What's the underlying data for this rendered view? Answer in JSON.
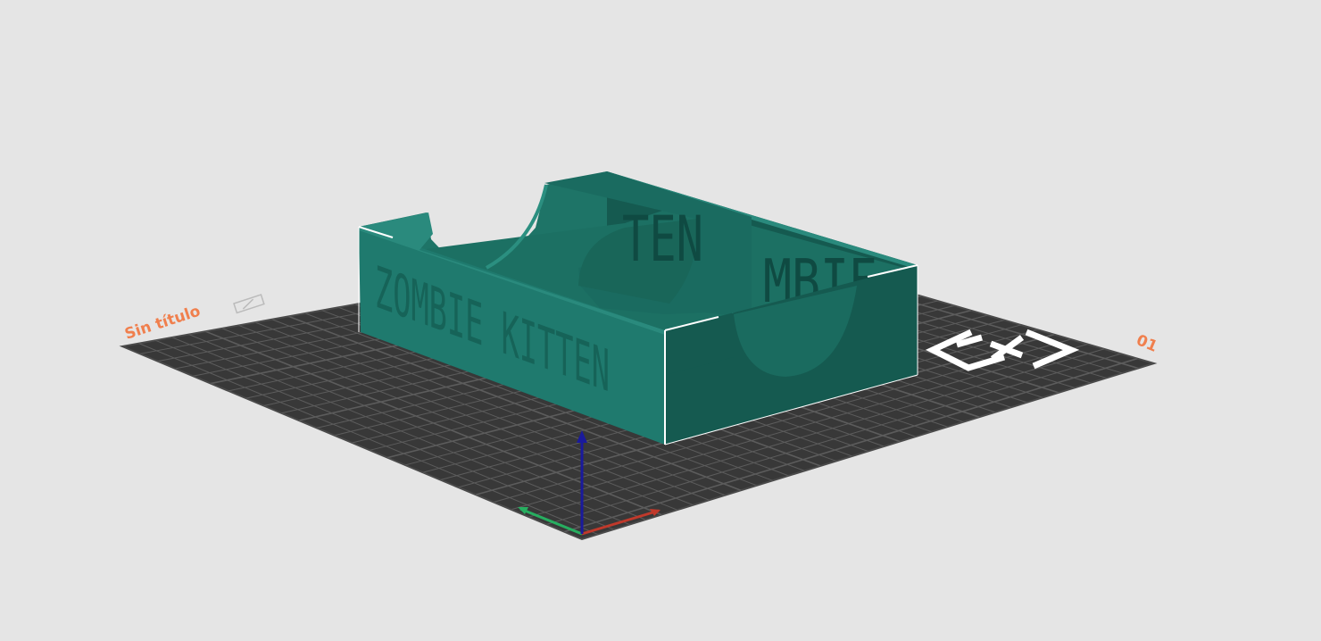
{
  "scene": {
    "background_color": "#e5e5e5",
    "bed_color": "#383838",
    "grid_color": "#5c5c5c",
    "model_color": "#1f7a6e",
    "model_shadow_color": "#145c52",
    "label_color": "#f07f4d"
  },
  "plate": {
    "name": "Sin título",
    "number": "01",
    "logo_icon": "printer-brand-logo"
  },
  "model": {
    "front_text": "ZOMBIE KITTEN",
    "back_text_visible": "TEN",
    "side_text_visible": "MBIE"
  },
  "axes": {
    "x_color": "#c0392b",
    "y_color": "#27ae60",
    "z_color": "#1a1a9c"
  }
}
